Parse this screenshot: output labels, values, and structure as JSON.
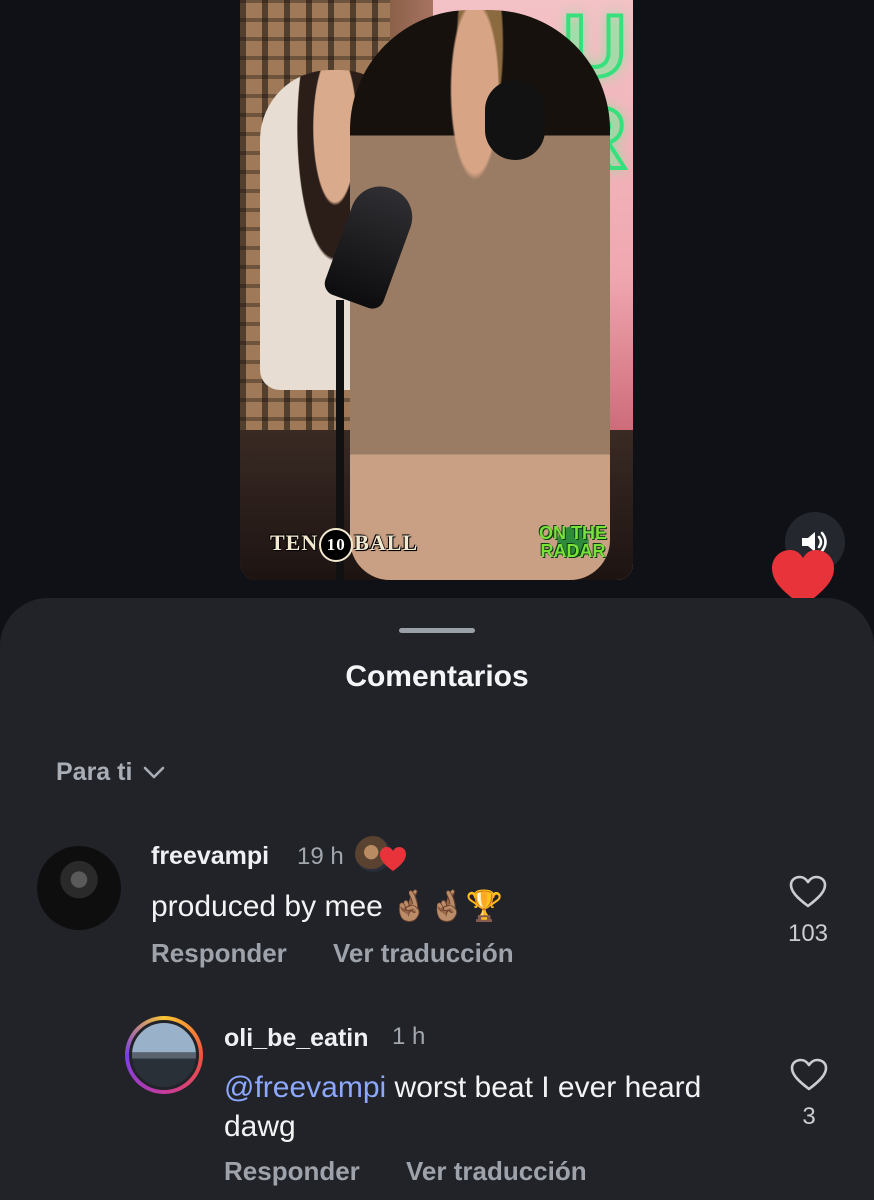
{
  "video": {
    "neon_sign_letters": "U\nR",
    "logo_left_prefix": "TEN",
    "logo_left_ball": "10",
    "logo_left_suffix": "BALL",
    "logo_right": "ON THE RADAR",
    "sound_icon": "speaker-on-icon",
    "like_icon": "heart-filled-icon",
    "like_color": "#e8333b"
  },
  "sheet": {
    "title": "Comentarios",
    "sort_label": "Para ti",
    "sort_icon": "chevron-down-icon"
  },
  "comments": [
    {
      "username": "freevampi",
      "time": "19 h",
      "text": "produced by mee 🤞🏽🤞🏽🏆",
      "reply_label": "Responder",
      "translate_label": "Ver traducción",
      "like_count": "103",
      "creator_liked": true
    },
    {
      "username": "oli_be_eatin",
      "time": "1 h",
      "mention": "@freevampi",
      "text": " worst beat I ever heard dawg",
      "reply_label": "Responder",
      "translate_label": "Ver traducción",
      "like_count": "3"
    }
  ],
  "colors": {
    "background": "#0f1116",
    "sheet": "#212328",
    "mention": "#8ca8ff",
    "heart": "#e8333b"
  }
}
